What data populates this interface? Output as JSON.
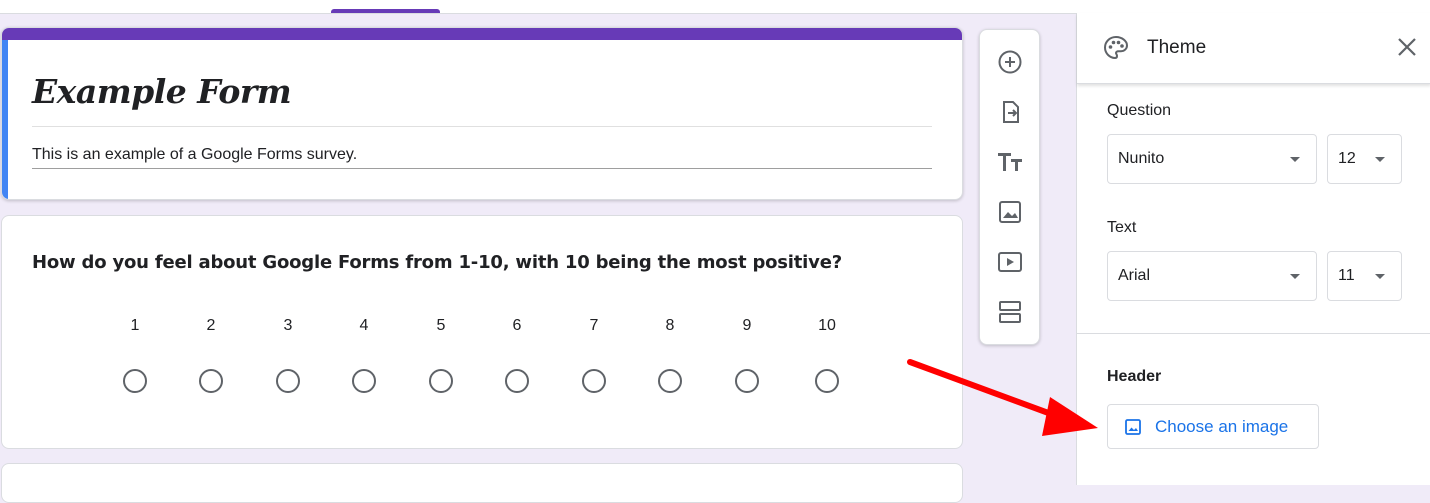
{
  "form": {
    "title": "Example Form",
    "description": "This is an example of a Google Forms survey."
  },
  "question": {
    "text": "How do you feel about Google Forms from 1-10, with 10 being the most positive?",
    "scale": [
      "1",
      "2",
      "3",
      "4",
      "5",
      "6",
      "7",
      "8",
      "9",
      "10"
    ]
  },
  "toolbar": {
    "icons": [
      "add-question-icon",
      "import-questions-icon",
      "add-title-icon",
      "add-image-icon",
      "add-video-icon",
      "add-section-icon"
    ]
  },
  "theme_panel": {
    "title": "Theme",
    "question_label": "Question",
    "question_font": "Nunito",
    "question_size": "12",
    "text_label": "Text",
    "text_font": "Arial",
    "text_size": "11",
    "header_label": "Header",
    "choose_image_label": "Choose an image"
  },
  "colors": {
    "accent": "#673ab7",
    "background": "#f0ebf8",
    "link_blue": "#1a73e8",
    "annotation_red": "#ff0000"
  }
}
